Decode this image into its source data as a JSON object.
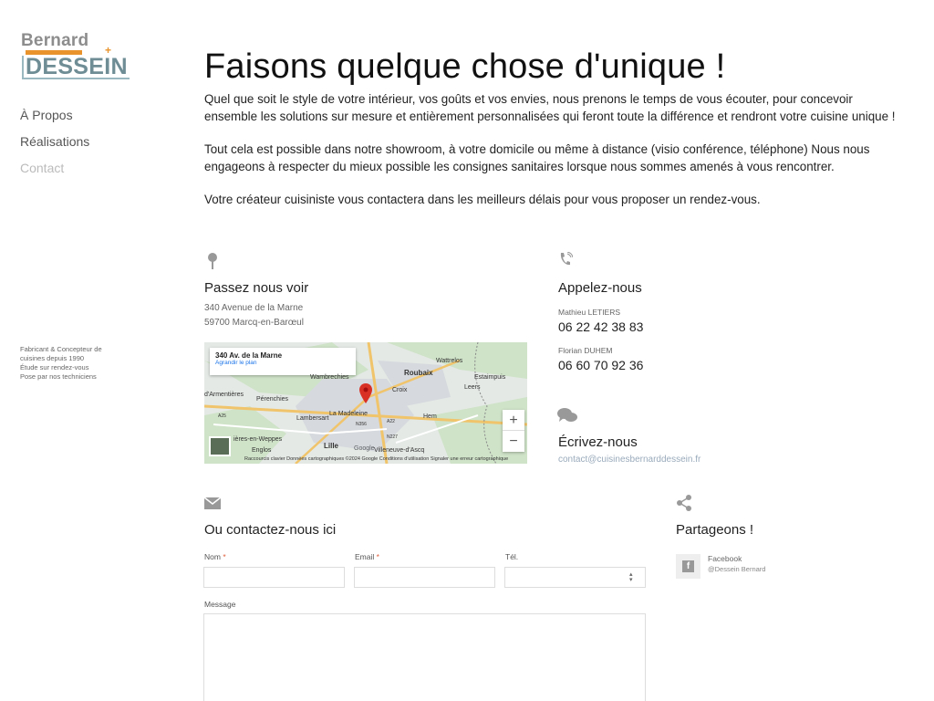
{
  "logo": {
    "line1": "Bernard",
    "line2": "DESSEIN",
    "plus": "+"
  },
  "nav": [
    {
      "label": "À Propos"
    },
    {
      "label": "Réalisations"
    },
    {
      "label": "Contact"
    }
  ],
  "tagline": [
    "Fabricant & Concepteur de",
    "cuisines depuis 1990",
    "Étude sur rendez-vous",
    "Pose par nos techniciens"
  ],
  "page": {
    "title": "Faisons quelque chose d'unique !",
    "paragraphs": [
      "Quel que soit le style de votre intérieur, vos goûts et vos envies, nous prenons le temps de vous écouter, pour concevoir ensemble les solutions sur mesure et entièrement personnalisées qui feront toute la différence et rendront votre cuisine unique !",
      "Tout cela est possible dans notre showroom, à votre domicile ou même à distance (visio conférence, téléphone) Nous nous engageons à respecter du mieux possible les consignes sanitaires lorsque nous sommes amenés à vous rencontrer.",
      "Votre créateur cuisiniste vous contactera dans les meilleurs délais pour vous proposer un rendez-vous."
    ]
  },
  "visit": {
    "heading": "Passez nous voir",
    "address1": "340 Avenue de la Marne",
    "address2": "59700 Marcq-en-Barœul"
  },
  "map": {
    "card_title": "340 Av. de la Marne",
    "card_link": "Agrandir le plan",
    "places": [
      "Wambrechies",
      "Roubaix",
      "Wattrelos",
      "Estaimpuis",
      "d'Armentières",
      "Pérenchies",
      "Croix",
      "Leers",
      "Lambersart",
      "La Madeleine",
      "Hem",
      "Lille",
      "ières-en-Weppes",
      "Englos",
      "Villeneuve-d'Ascq",
      "A25",
      "A22",
      "N356",
      "N227"
    ],
    "attribution": "Raccourcis clavier   Données cartographiques ©2024 Google   Conditions d'utilisation   Signaler une erreur cartographique",
    "zoom_in": "+",
    "zoom_out": "−",
    "google": "Google"
  },
  "call": {
    "heading": "Appelez-nous",
    "contacts": [
      {
        "name": "Mathieu LETIERS",
        "phone": "06 22 42 38 83"
      },
      {
        "name": "Florian DUHEM",
        "phone": "06 60 70 92 36"
      }
    ]
  },
  "write": {
    "heading": "Écrivez-nous",
    "email": "contact@cuisinesbernarddessein.fr"
  },
  "form": {
    "heading": "Ou contactez-nous ici",
    "name_label": "Nom",
    "email_label": "Email",
    "tel_label": "Tél.",
    "message_label": "Message",
    "required_mark": "*"
  },
  "share": {
    "heading": "Partageons !",
    "network": "Facebook",
    "handle": "@Dessein Bernard",
    "fb_glyph": "f"
  },
  "icons": {
    "pin": "map-pin-icon",
    "phone": "phone-icon",
    "chat": "chat-bubbles-icon",
    "mail": "envelope-icon",
    "share": "share-icon"
  },
  "colors": {
    "accent": "#e8932c",
    "logo_blue": "#6e8d95",
    "logo_grey": "#8d8d8d",
    "map_pin": "#d93025"
  }
}
